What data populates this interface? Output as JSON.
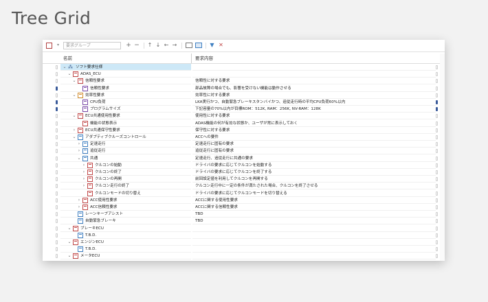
{
  "page_title": "Tree Grid",
  "toolbar": {
    "search_placeholder": "要求グループ",
    "buttons": [
      "+",
      "−",
      "↑",
      "↓",
      "←",
      "→"
    ]
  },
  "header": {
    "name": "名前",
    "description": "要求内容"
  },
  "rows": [
    {
      "level": 0,
      "exp": "down",
      "icon": "grp",
      "name": "ソフト要求仕様",
      "desc": "",
      "gutter": "light",
      "right": "light",
      "selected": true
    },
    {
      "level": 1,
      "exp": "down",
      "icon": "red",
      "name": "ADAS_ECU",
      "desc": "",
      "gutter": "light",
      "right": "light"
    },
    {
      "level": 2,
      "exp": "down",
      "icon": "red",
      "name": "信頼性要求",
      "desc": "信頼性に対する要求",
      "gutter": "light",
      "right": "light"
    },
    {
      "level": 3,
      "exp": "",
      "icon": "purple",
      "name": "信頼性要求",
      "desc": "部品故障の場合でも、影響を受けない機能は動作させる",
      "gutter": "dark",
      "right": "light"
    },
    {
      "level": 2,
      "exp": "down",
      "icon": "orange",
      "name": "効率性要求",
      "desc": "効率性に対する要求",
      "gutter": "light",
      "right": "light"
    },
    {
      "level": 3,
      "exp": "",
      "icon": "purple",
      "name": "CPU負荷",
      "desc": "LKA実行かつ、自動緊急ブレーキスタンバイかつ、追従走行時の平均CPU負荷60%以内",
      "gutter": "dark",
      "right": "dark"
    },
    {
      "level": 3,
      "exp": "",
      "icon": "purple",
      "name": "プログラムサイズ",
      "desc": "下記容量の70%以内が目標ROM：512K, RAM：256K, NV-RAM：128K",
      "gutter": "dark",
      "right": "dark"
    },
    {
      "level": 2,
      "exp": "down",
      "icon": "red",
      "name": "ECU共通使用性要求",
      "desc": "使用性に対する要求",
      "gutter": "light",
      "right": "light"
    },
    {
      "level": 3,
      "exp": "",
      "icon": "red",
      "name": "機能の状態表示",
      "desc": "ADAS機能の何が有効な状態か、ユーザが常に表示しておく",
      "gutter": "light",
      "right": "light"
    },
    {
      "level": 2,
      "exp": "right",
      "icon": "red",
      "name": "ECU共通保守性要求",
      "desc": "保守性に対する要求",
      "gutter": "light",
      "right": "light"
    },
    {
      "level": 2,
      "exp": "down",
      "icon": "blue",
      "name": "アダプティブクルーズコントロール",
      "desc": "ACCへの要件",
      "gutter": "light",
      "right": "light"
    },
    {
      "level": 3,
      "exp": "right",
      "icon": "blue",
      "name": "定速走行",
      "desc": "定速走行に固有の要求",
      "gutter": "light",
      "right": "light"
    },
    {
      "level": 3,
      "exp": "right",
      "icon": "blue",
      "name": "追従走行",
      "desc": "追従走行に固有の要求",
      "gutter": "light",
      "right": "light"
    },
    {
      "level": 3,
      "exp": "down",
      "icon": "blue",
      "name": "共通",
      "desc": "定速走行、追従走行に共通の要求",
      "gutter": "light",
      "right": "light"
    },
    {
      "level": 4,
      "exp": "right",
      "icon": "red",
      "name": "クルコンの始動",
      "desc": "ドライバの要求に応じてクルコンを始動する",
      "gutter": "light",
      "right": "light"
    },
    {
      "level": 4,
      "exp": "right",
      "icon": "red",
      "name": "クルコンの終了",
      "desc": "ドライバの要求に応じてクルコンを終了する",
      "gutter": "light",
      "right": "light"
    },
    {
      "level": 4,
      "exp": "right",
      "icon": "red",
      "name": "クルコンの再開",
      "desc": "前回設定値を利用してクルコンを再開する",
      "gutter": "light",
      "right": "light"
    },
    {
      "level": 4,
      "exp": "right",
      "icon": "red",
      "name": "クルコン走行の終了",
      "desc": "クルコン走行中に一定の条件が満たされた場合、クルコンを終了させる",
      "gutter": "light",
      "right": "light"
    },
    {
      "level": 4,
      "exp": "",
      "icon": "red",
      "name": "クルコンモードの切り替え",
      "desc": "ドライバの要求に応じてクルコンモードを切り替える",
      "gutter": "light",
      "right": "light"
    },
    {
      "level": 3,
      "exp": "right",
      "icon": "red",
      "name": "ACC使用性要求",
      "desc": "ACCに関する使用性要求",
      "gutter": "light",
      "right": "light"
    },
    {
      "level": 3,
      "exp": "right",
      "icon": "red",
      "name": "ACC信頼性要求",
      "desc": "ACCに関する信頼性要求",
      "gutter": "light",
      "right": "light"
    },
    {
      "level": 2,
      "exp": "",
      "icon": "blue",
      "name": "レーンキープアシスト",
      "desc": "TBD",
      "gutter": "light",
      "right": "light"
    },
    {
      "level": 2,
      "exp": "",
      "icon": "blue",
      "name": "自動緊急ブレーキ",
      "desc": "TBD",
      "gutter": "light",
      "right": "light"
    },
    {
      "level": 1,
      "exp": "down",
      "icon": "red",
      "name": "ブレーキECU",
      "desc": "",
      "gutter": "light",
      "right": "light"
    },
    {
      "level": 2,
      "exp": "",
      "icon": "blue",
      "name": "T.B.D.",
      "desc": "",
      "gutter": "light",
      "right": "light"
    },
    {
      "level": 1,
      "exp": "down",
      "icon": "red",
      "name": "エンジンECU",
      "desc": "",
      "gutter": "light",
      "right": "light"
    },
    {
      "level": 2,
      "exp": "",
      "icon": "blue",
      "name": "T.B.D.",
      "desc": "",
      "gutter": "light",
      "right": "light"
    },
    {
      "level": 1,
      "exp": "down",
      "icon": "red",
      "name": "メータECU",
      "desc": "",
      "gutter": "light",
      "right": "light"
    }
  ]
}
